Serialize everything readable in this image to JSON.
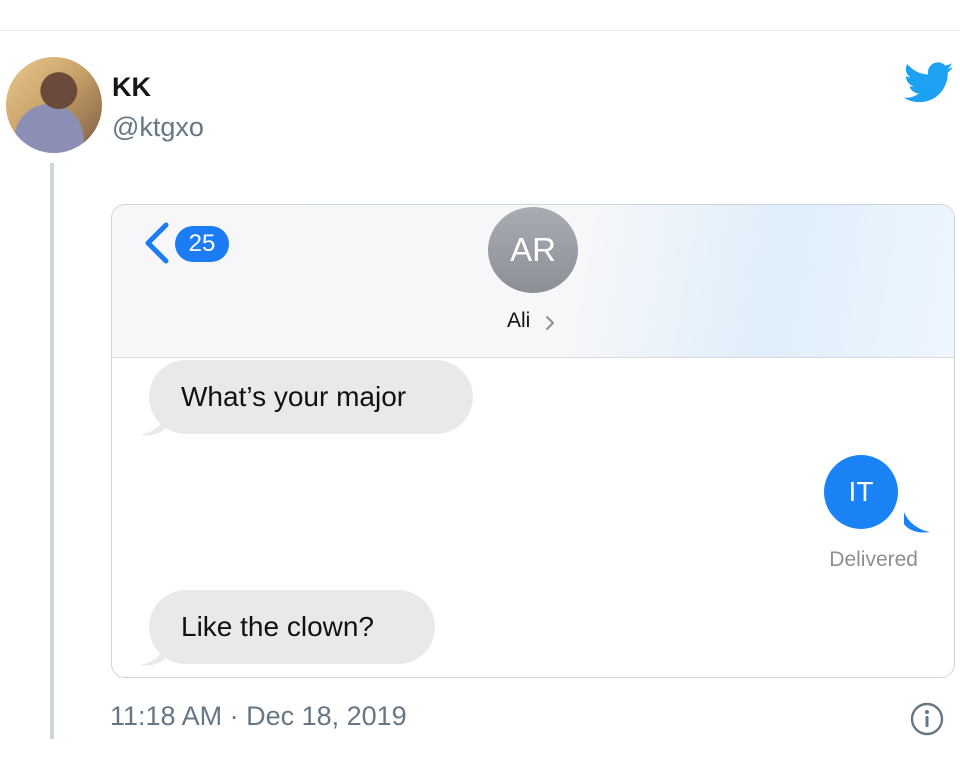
{
  "tweet": {
    "display_name": "KK",
    "handle": "@ktgxo",
    "timestamp": "11:18 AM · Dec 18, 2019",
    "icons": {
      "brand": "twitter-bird-icon",
      "info": "info-icon"
    },
    "colors": {
      "brand": "#1da1f2",
      "secondary_text": "#657786"
    }
  },
  "imessage": {
    "unread_count": "25",
    "contact_initials": "AR",
    "contact_name": "Ali",
    "messages": [
      {
        "direction": "incoming",
        "text": "What’s your major"
      },
      {
        "direction": "outgoing",
        "text": "IT"
      },
      {
        "direction": "incoming",
        "text": "Like the clown?"
      }
    ],
    "delivery_status": "Delivered",
    "colors": {
      "outgoing_bubble": "#1b82f6",
      "incoming_bubble": "#e9e9eb"
    }
  }
}
